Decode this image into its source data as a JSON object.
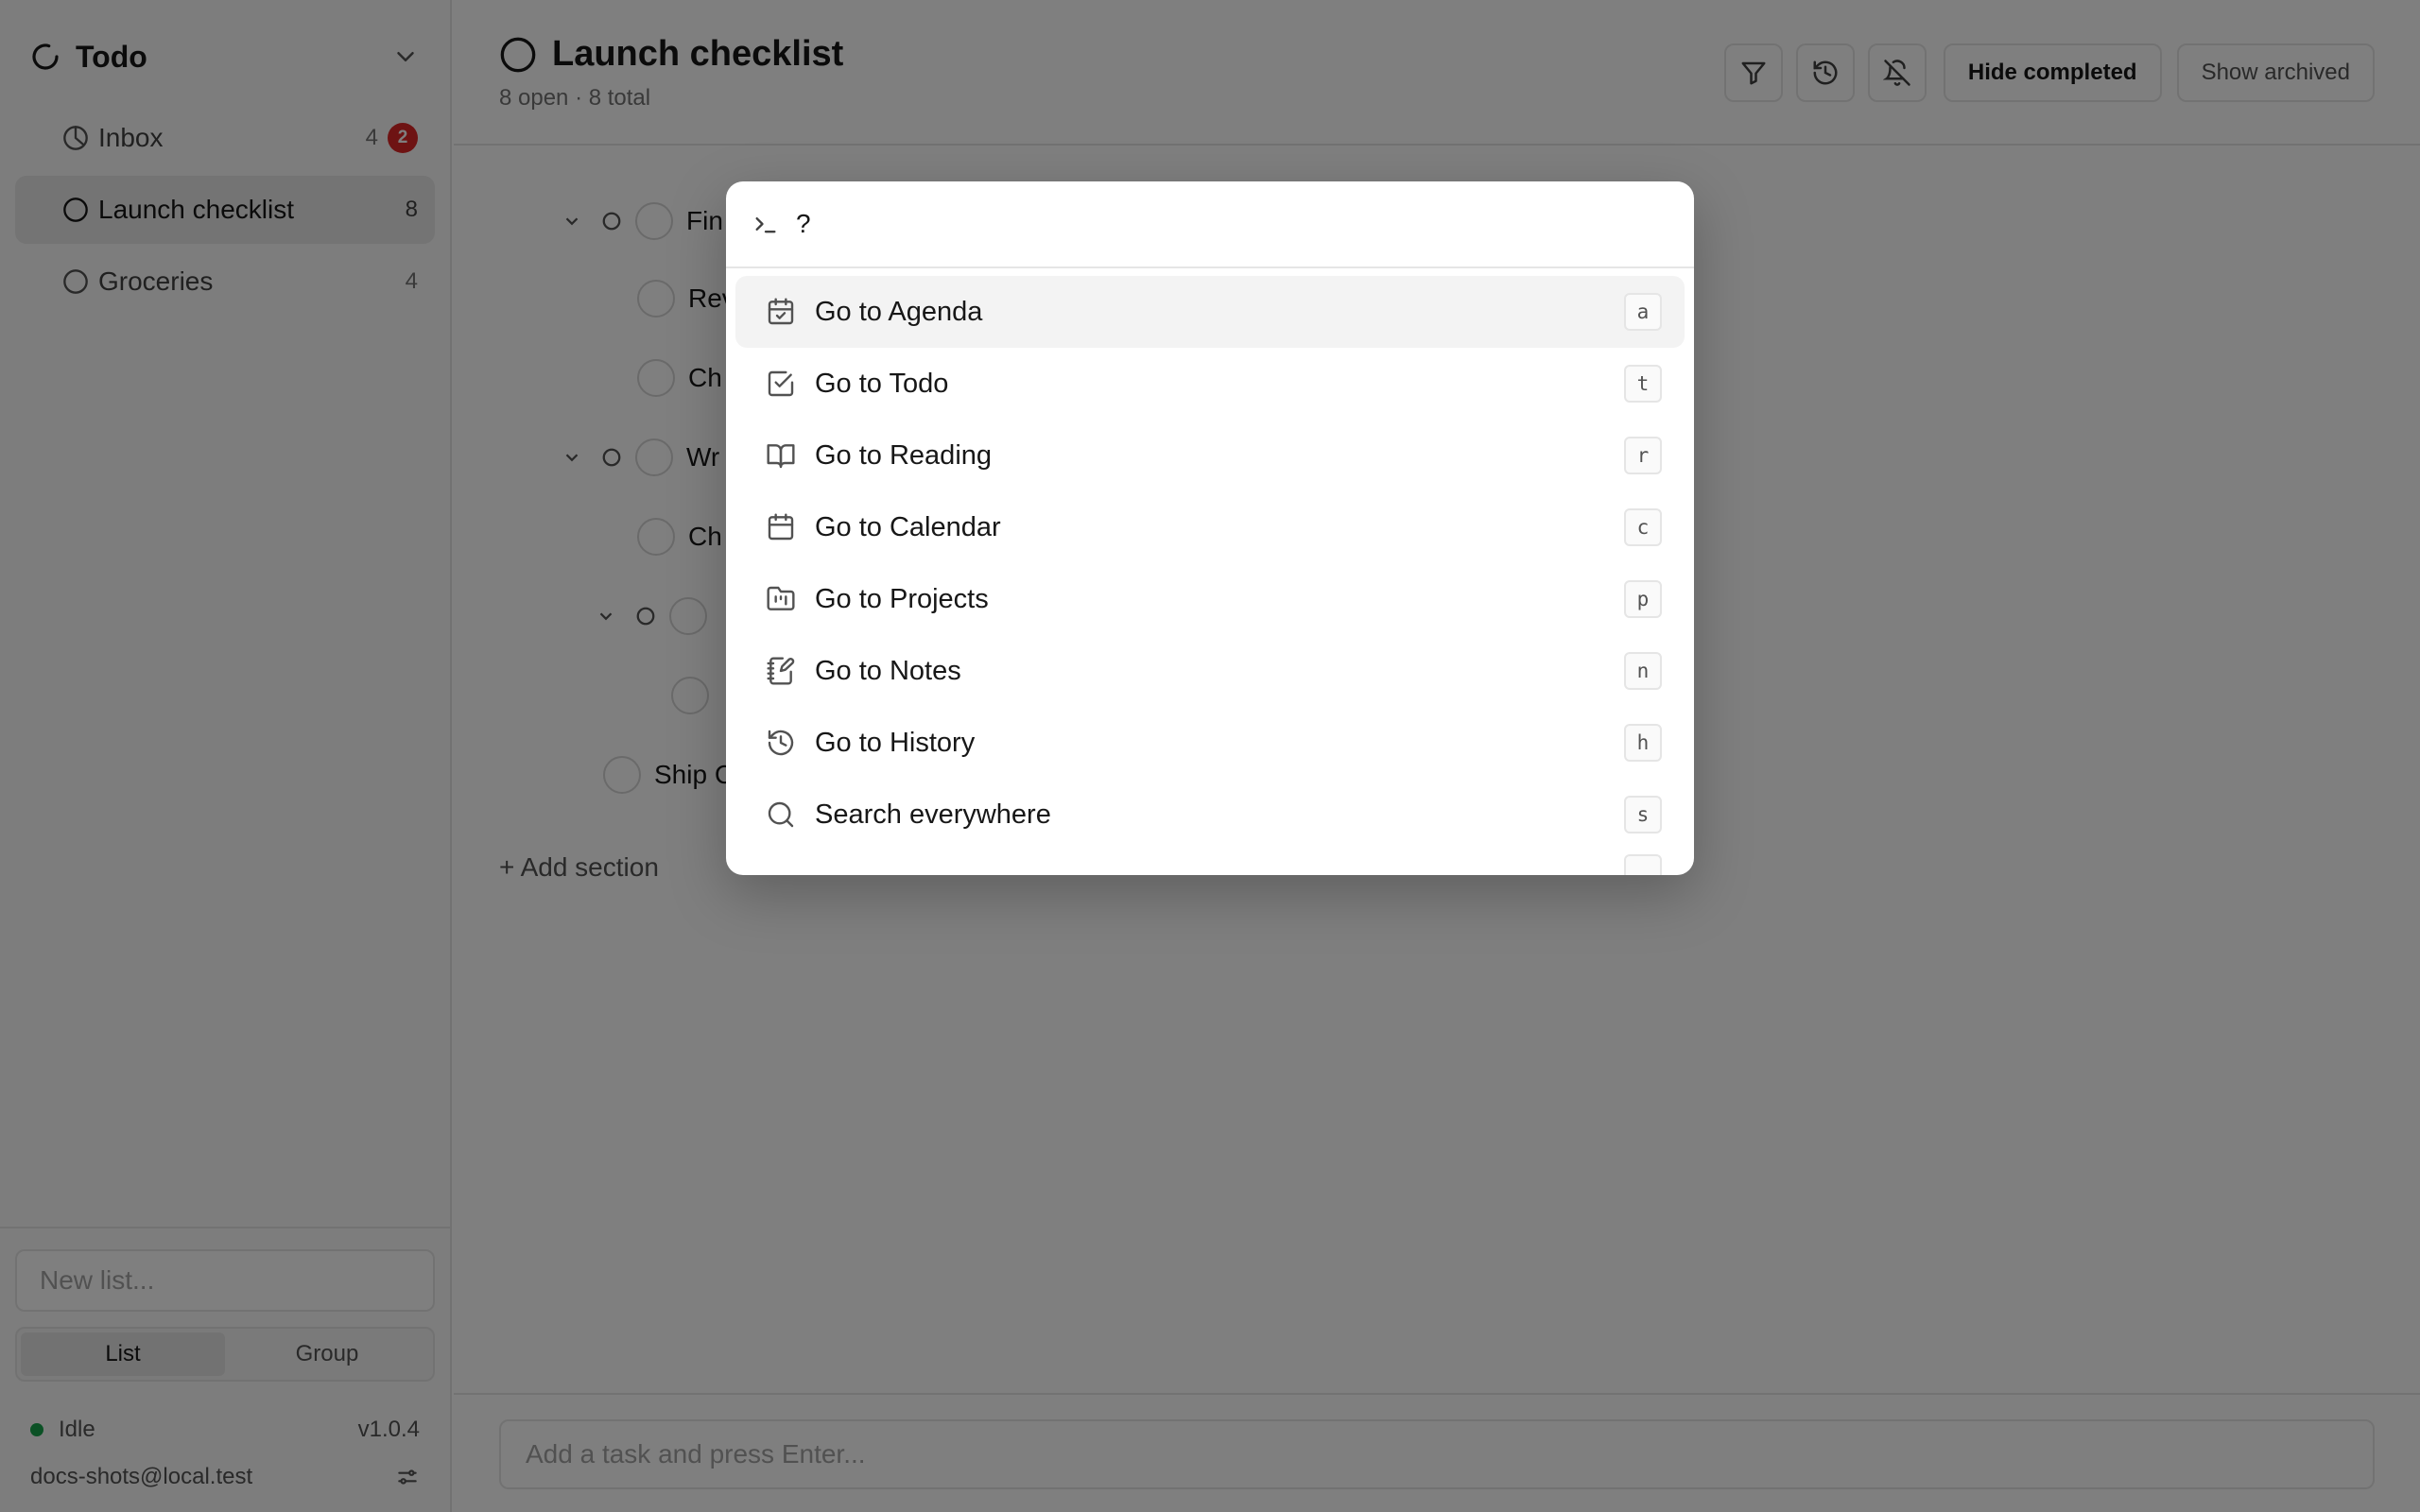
{
  "sidebar": {
    "app_title": "Todo",
    "lists": [
      {
        "label": "Inbox",
        "count": "4",
        "badge": "2"
      },
      {
        "label": "Launch checklist",
        "count": "8"
      },
      {
        "label": "Groceries",
        "count": "4"
      }
    ],
    "new_list_placeholder": "New list...",
    "view_modes": [
      "List",
      "Group"
    ],
    "active_view_mode": "List",
    "status": "Idle",
    "version": "v1.0.4",
    "user_email": "docs-shots@local.test"
  },
  "main": {
    "title": "Launch checklist",
    "subtitle": "8 open · 8 total",
    "toolbar": {
      "hide_completed": "Hide completed",
      "show_archived": "Show archived"
    },
    "tasks": [
      {
        "text": "Fin"
      },
      {
        "text": "Rev"
      },
      {
        "text": "Ch"
      },
      {
        "text": "Wr"
      },
      {
        "text": "Ch"
      },
      {
        "text": ""
      },
      {
        "text": ""
      },
      {
        "text": "Ship C"
      }
    ],
    "add_section": "+ Add section",
    "composer_placeholder": "Add a task and press Enter..."
  },
  "palette": {
    "query": "?",
    "commands": [
      {
        "label": "Go to Agenda",
        "key": "a",
        "icon": "calendar-check-icon"
      },
      {
        "label": "Go to Todo",
        "key": "t",
        "icon": "square-check-icon"
      },
      {
        "label": "Go to Reading",
        "key": "r",
        "icon": "book-open-icon"
      },
      {
        "label": "Go to Calendar",
        "key": "c",
        "icon": "calendar-icon"
      },
      {
        "label": "Go to Projects",
        "key": "p",
        "icon": "folder-kanban-icon"
      },
      {
        "label": "Go to Notes",
        "key": "n",
        "icon": "notebook-pen-icon"
      },
      {
        "label": "Go to History",
        "key": "h",
        "icon": "history-icon"
      },
      {
        "label": "Search everywhere",
        "key": "s",
        "icon": "search-icon"
      }
    ]
  },
  "colors": {
    "accent_status": "#16a34a",
    "badge": "#dc2626",
    "overlay": "rgba(0,0,0,0.5)"
  }
}
